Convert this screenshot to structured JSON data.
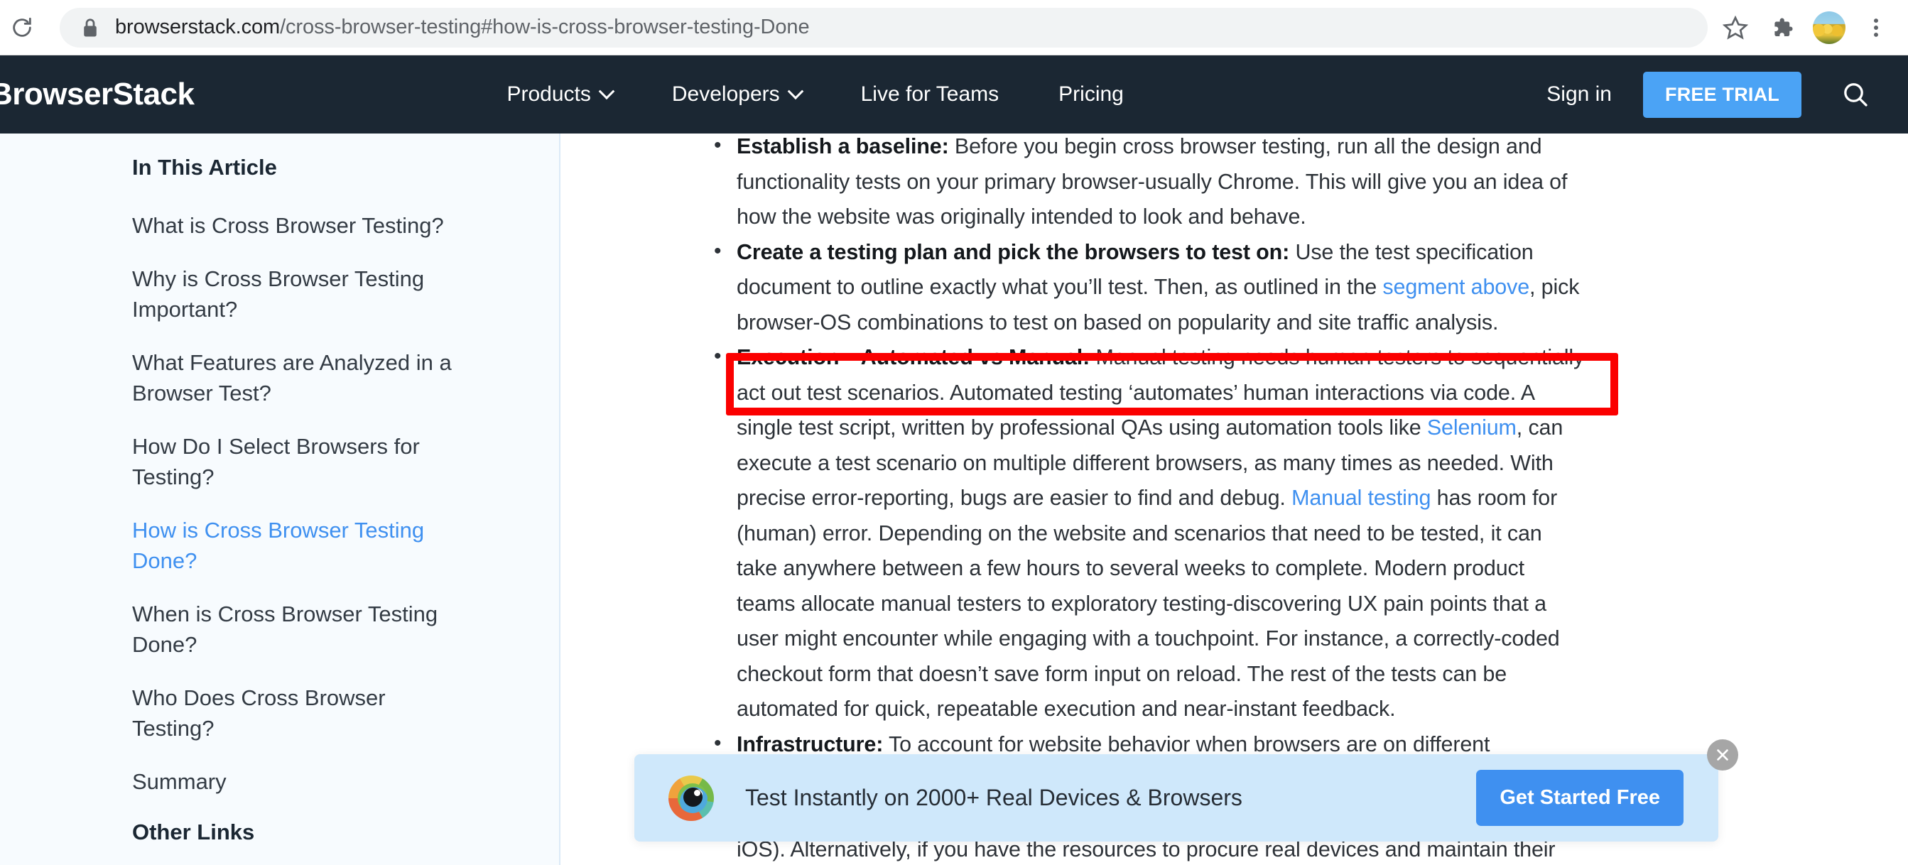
{
  "browser": {
    "reload_icon": "reload-icon",
    "lock_icon": "lock-icon",
    "url_host": "browserstack.com",
    "url_path": "/cross-browser-testing#how-is-cross-browser-testing-Done",
    "bookmark_icon": "star-icon",
    "extensions_icon": "puzzle-piece-icon",
    "profile_icon": "avatar-icon",
    "menu_icon": "three-dot-menu-icon"
  },
  "site_header": {
    "logo": "BrowserStack",
    "nav": [
      {
        "label": "Products",
        "has_chevron": true
      },
      {
        "label": "Developers",
        "has_chevron": true
      },
      {
        "label": "Live for Teams",
        "has_chevron": false
      },
      {
        "label": "Pricing",
        "has_chevron": false
      }
    ],
    "sign_in": "Sign in",
    "free_trial": "FREE TRIAL",
    "search_icon": "search-icon",
    "accent_color": "#4ba3f5",
    "background_color": "#1b2733"
  },
  "sidebar": {
    "title": "In This Article",
    "items": [
      {
        "label": "What is Cross Browser Testing?",
        "active": false
      },
      {
        "label": "Why is Cross Browser Testing Important?",
        "active": false
      },
      {
        "label": "What Features are Analyzed in a Browser Test?",
        "active": false
      },
      {
        "label": "How Do I Select Browsers for Testing?",
        "active": false
      },
      {
        "label": "How is Cross Browser Testing Done?",
        "active": true
      },
      {
        "label": "When is Cross Browser Testing Done?",
        "active": false
      },
      {
        "label": "Who Does Cross Browser Testing?",
        "active": false
      },
      {
        "label": "Summary",
        "active": false
      }
    ],
    "other_links_title": "Other Links",
    "active_color": "#3f90f0",
    "background_color": "#f7fbfe"
  },
  "article": {
    "bullets": [
      {
        "lead": "Establish a baseline:",
        "body_1": " Before you begin cross browser testing, run all the design and functionality tests on your primary browser-usually Chrome. This will give you an idea of how the website was originally intended to look and behave."
      },
      {
        "lead": "Create a testing plan and pick the browsers to test on:",
        "body_1": " Use the test specification document to outline exactly what you’ll test. Then, as outlined in the ",
        "link_1": "segment above",
        "body_2": ", pick browser-OS combinations to test on based on popularity and site traffic analysis."
      },
      {
        "lead": "Execution—Automated vs Manual:",
        "body_1": " Manual testing needs human testers to sequentially act out test scenarios. Automated testing ‘automates’ human interactions via code. A single test script, written by professional QAs using automation tools like ",
        "link_1": "Selenium",
        "body_2": ", can execute a test scenario on multiple different browsers, as many times as needed. With precise error-reporting, bugs are easier to find and debug. ",
        "link_2": "Manual testing",
        "body_3": " has room for (human) error. Depending on the website and scenarios that need to be tested, it can take anywhere between a few hours to several weeks to complete. Modern product teams allocate manual testers to exploratory testing-discovering UX pain points that a user might encounter while engaging with a touchpoint. For instance, a correctly-coded checkout form that doesn’t save form input on reload. The rest of the tests can be automated for quick, repeatable execution and near-instant feedback."
      },
      {
        "lead": "Infrastructure:",
        "body_1": " To account for website behavior when browsers are on different operating systems, you’ll need different devices. There are several ways to go about setting up your"
      }
    ],
    "cut_off_line": "iOS). Alternatively, if you have the resources to procure real devices and maintain their",
    "link_color": "#3f90f0"
  },
  "annotation": {
    "highlight_color": "#fb0000",
    "shape": "rectangle-outline"
  },
  "banner": {
    "logo_icon": "browserstack-eye-icon",
    "text": "Test Instantly on 2000+ Real Devices & Browsers",
    "cta_label": "Get Started Free",
    "close_icon": "close-icon",
    "background_color": "#cfe8fb",
    "cta_color": "#3f90f0"
  }
}
